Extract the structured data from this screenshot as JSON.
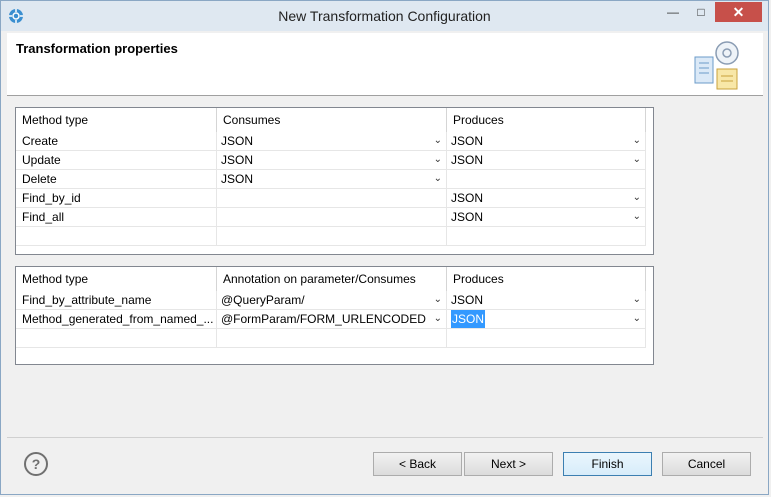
{
  "window": {
    "title": "New Transformation Configuration",
    "minimize": "—",
    "maximize": "□",
    "close": "✕"
  },
  "header": {
    "title": "Transformation properties"
  },
  "table1": {
    "columns": [
      "Method type",
      "Consumes",
      "Produces"
    ],
    "rows": [
      {
        "method": "Create",
        "consumes": "JSON",
        "produces": "JSON"
      },
      {
        "method": "Update",
        "consumes": "JSON",
        "produces": "JSON"
      },
      {
        "method": "Delete",
        "consumes": "JSON",
        "produces": ""
      },
      {
        "method": "Find_by_id",
        "consumes": "",
        "produces": "JSON"
      },
      {
        "method": "Find_all",
        "consumes": "",
        "produces": "JSON"
      }
    ]
  },
  "table2": {
    "columns": [
      "Method type",
      "Annotation on parameter/Consumes",
      "Produces"
    ],
    "rows": [
      {
        "method": "Find_by_attribute_name",
        "consumes": "@QueryParam/",
        "produces": "JSON"
      },
      {
        "method": "Method_generated_from_named_...",
        "consumes": "@FormParam/FORM_URLENCODED",
        "produces": "JSON"
      }
    ]
  },
  "buttons": {
    "help": "?",
    "back": "< Back",
    "next": "Next >",
    "finish": "Finish",
    "cancel": "Cancel"
  },
  "colors": {
    "selection": "#3399ff",
    "close_button": "#c7504a"
  }
}
